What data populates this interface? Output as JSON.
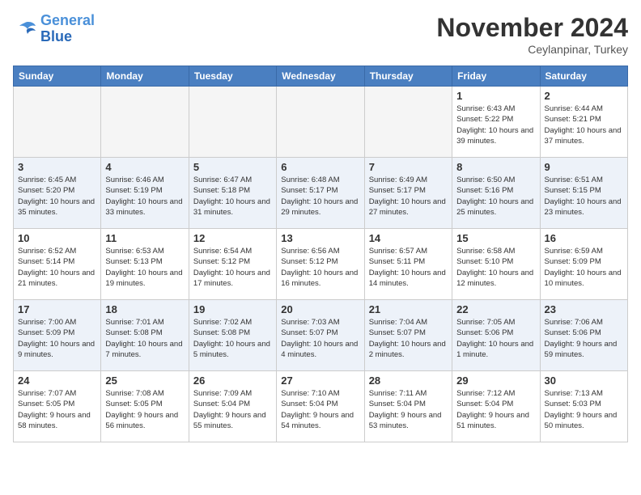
{
  "logo": {
    "line1": "General",
    "line2": "Blue"
  },
  "title": "November 2024",
  "location": "Ceylanpinar, Turkey",
  "weekdays": [
    "Sunday",
    "Monday",
    "Tuesday",
    "Wednesday",
    "Thursday",
    "Friday",
    "Saturday"
  ],
  "weeks": [
    [
      {
        "day": "",
        "info": ""
      },
      {
        "day": "",
        "info": ""
      },
      {
        "day": "",
        "info": ""
      },
      {
        "day": "",
        "info": ""
      },
      {
        "day": "",
        "info": ""
      },
      {
        "day": "1",
        "info": "Sunrise: 6:43 AM\nSunset: 5:22 PM\nDaylight: 10 hours and 39 minutes."
      },
      {
        "day": "2",
        "info": "Sunrise: 6:44 AM\nSunset: 5:21 PM\nDaylight: 10 hours and 37 minutes."
      }
    ],
    [
      {
        "day": "3",
        "info": "Sunrise: 6:45 AM\nSunset: 5:20 PM\nDaylight: 10 hours and 35 minutes."
      },
      {
        "day": "4",
        "info": "Sunrise: 6:46 AM\nSunset: 5:19 PM\nDaylight: 10 hours and 33 minutes."
      },
      {
        "day": "5",
        "info": "Sunrise: 6:47 AM\nSunset: 5:18 PM\nDaylight: 10 hours and 31 minutes."
      },
      {
        "day": "6",
        "info": "Sunrise: 6:48 AM\nSunset: 5:17 PM\nDaylight: 10 hours and 29 minutes."
      },
      {
        "day": "7",
        "info": "Sunrise: 6:49 AM\nSunset: 5:17 PM\nDaylight: 10 hours and 27 minutes."
      },
      {
        "day": "8",
        "info": "Sunrise: 6:50 AM\nSunset: 5:16 PM\nDaylight: 10 hours and 25 minutes."
      },
      {
        "day": "9",
        "info": "Sunrise: 6:51 AM\nSunset: 5:15 PM\nDaylight: 10 hours and 23 minutes."
      }
    ],
    [
      {
        "day": "10",
        "info": "Sunrise: 6:52 AM\nSunset: 5:14 PM\nDaylight: 10 hours and 21 minutes."
      },
      {
        "day": "11",
        "info": "Sunrise: 6:53 AM\nSunset: 5:13 PM\nDaylight: 10 hours and 19 minutes."
      },
      {
        "day": "12",
        "info": "Sunrise: 6:54 AM\nSunset: 5:12 PM\nDaylight: 10 hours and 17 minutes."
      },
      {
        "day": "13",
        "info": "Sunrise: 6:56 AM\nSunset: 5:12 PM\nDaylight: 10 hours and 16 minutes."
      },
      {
        "day": "14",
        "info": "Sunrise: 6:57 AM\nSunset: 5:11 PM\nDaylight: 10 hours and 14 minutes."
      },
      {
        "day": "15",
        "info": "Sunrise: 6:58 AM\nSunset: 5:10 PM\nDaylight: 10 hours and 12 minutes."
      },
      {
        "day": "16",
        "info": "Sunrise: 6:59 AM\nSunset: 5:09 PM\nDaylight: 10 hours and 10 minutes."
      }
    ],
    [
      {
        "day": "17",
        "info": "Sunrise: 7:00 AM\nSunset: 5:09 PM\nDaylight: 10 hours and 9 minutes."
      },
      {
        "day": "18",
        "info": "Sunrise: 7:01 AM\nSunset: 5:08 PM\nDaylight: 10 hours and 7 minutes."
      },
      {
        "day": "19",
        "info": "Sunrise: 7:02 AM\nSunset: 5:08 PM\nDaylight: 10 hours and 5 minutes."
      },
      {
        "day": "20",
        "info": "Sunrise: 7:03 AM\nSunset: 5:07 PM\nDaylight: 10 hours and 4 minutes."
      },
      {
        "day": "21",
        "info": "Sunrise: 7:04 AM\nSunset: 5:07 PM\nDaylight: 10 hours and 2 minutes."
      },
      {
        "day": "22",
        "info": "Sunrise: 7:05 AM\nSunset: 5:06 PM\nDaylight: 10 hours and 1 minute."
      },
      {
        "day": "23",
        "info": "Sunrise: 7:06 AM\nSunset: 5:06 PM\nDaylight: 9 hours and 59 minutes."
      }
    ],
    [
      {
        "day": "24",
        "info": "Sunrise: 7:07 AM\nSunset: 5:05 PM\nDaylight: 9 hours and 58 minutes."
      },
      {
        "day": "25",
        "info": "Sunrise: 7:08 AM\nSunset: 5:05 PM\nDaylight: 9 hours and 56 minutes."
      },
      {
        "day": "26",
        "info": "Sunrise: 7:09 AM\nSunset: 5:04 PM\nDaylight: 9 hours and 55 minutes."
      },
      {
        "day": "27",
        "info": "Sunrise: 7:10 AM\nSunset: 5:04 PM\nDaylight: 9 hours and 54 minutes."
      },
      {
        "day": "28",
        "info": "Sunrise: 7:11 AM\nSunset: 5:04 PM\nDaylight: 9 hours and 53 minutes."
      },
      {
        "day": "29",
        "info": "Sunrise: 7:12 AM\nSunset: 5:04 PM\nDaylight: 9 hours and 51 minutes."
      },
      {
        "day": "30",
        "info": "Sunrise: 7:13 AM\nSunset: 5:03 PM\nDaylight: 9 hours and 50 minutes."
      }
    ]
  ]
}
